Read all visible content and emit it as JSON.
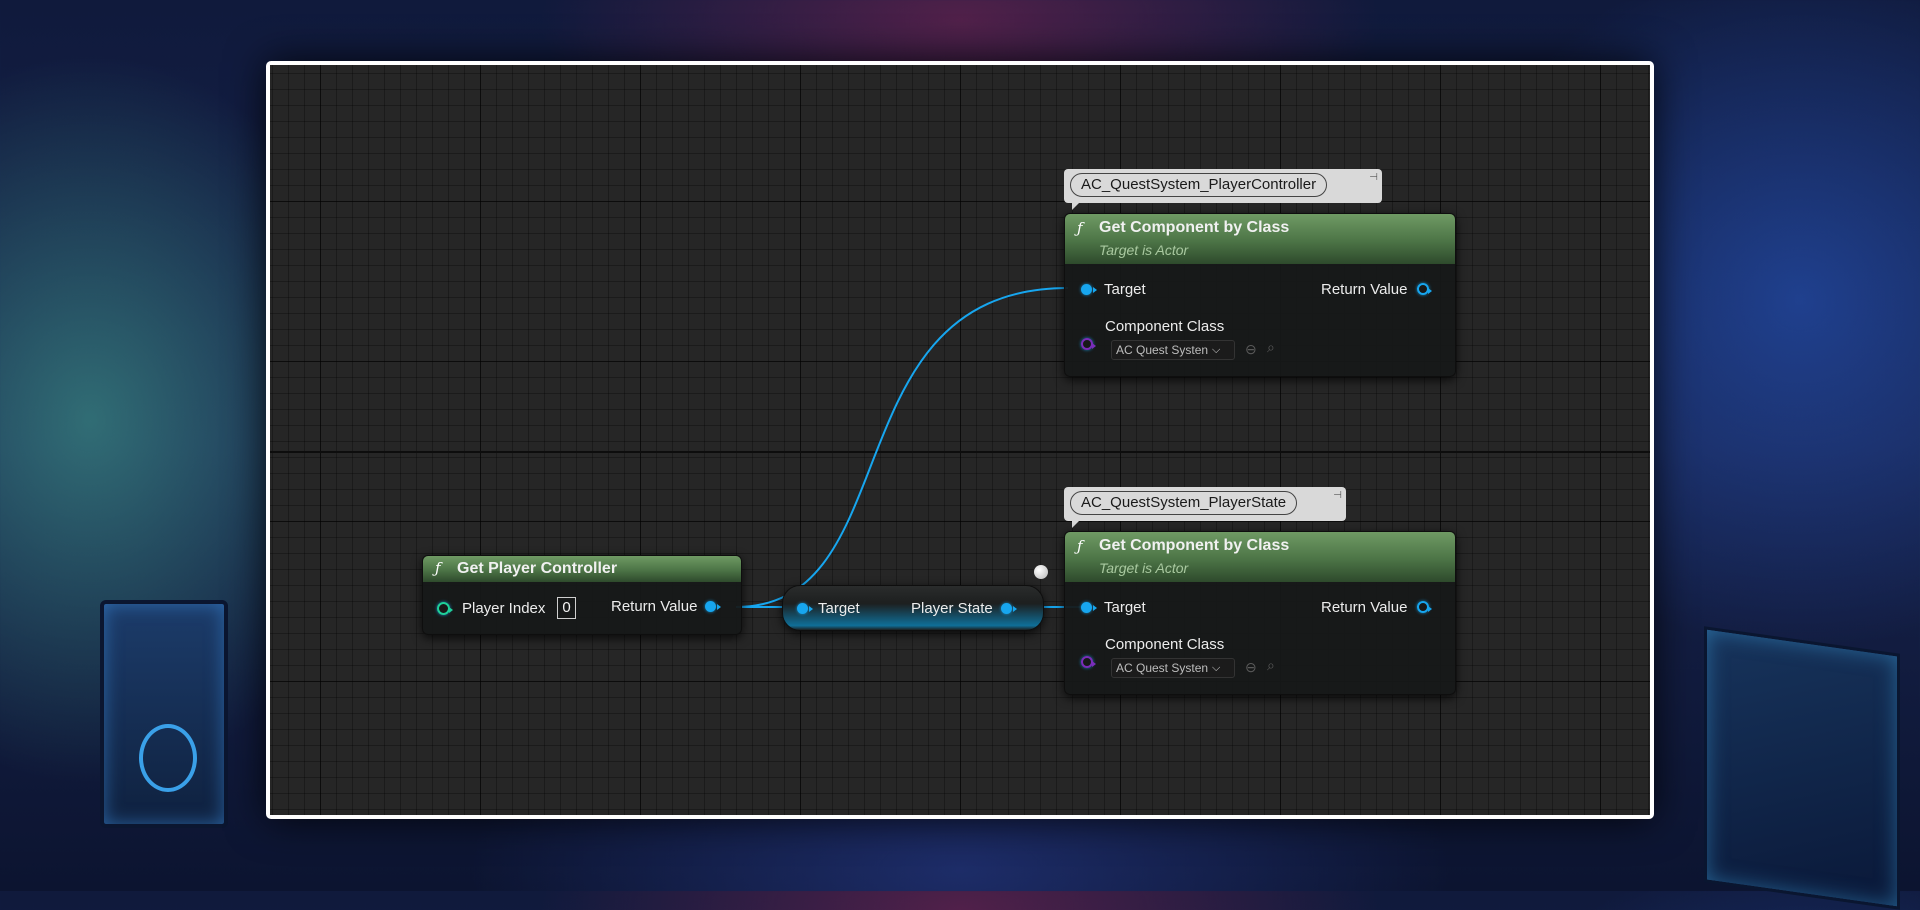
{
  "colors": {
    "exec_pin": "#17a6ef",
    "class_pin": "#7a2dba",
    "int_pin": "#1fcf9a",
    "function_header": "#4c7446",
    "wire": "#17a6ef"
  },
  "nodes": {
    "get_player_controller": {
      "icon": "function-icon",
      "title": "Get Player Controller",
      "player_index_label": "Player Index",
      "player_index_value": "0",
      "return_label": "Return Value"
    },
    "player_state_getter": {
      "target_label": "Target",
      "output_label": "Player State"
    },
    "get_component_pc": {
      "comment": "AC_QuestSystem_PlayerController",
      "title": "Get Component by Class",
      "subtitle": "Target is Actor",
      "target_label": "Target",
      "return_label": "Return Value",
      "component_class_label": "Component Class",
      "component_class_value": "AC Quest Systen"
    },
    "get_component_ps": {
      "comment": "AC_QuestSystem_PlayerState",
      "title": "Get Component by Class",
      "subtitle": "Target is Actor",
      "target_label": "Target",
      "return_label": "Return Value",
      "component_class_label": "Component Class",
      "component_class_value": "AC Quest Systen"
    }
  }
}
